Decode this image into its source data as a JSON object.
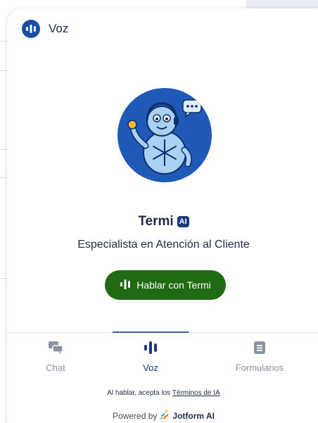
{
  "header": {
    "title": "Voz",
    "logo_icon": "voice-bars-icon",
    "accent": "#1b4ea3"
  },
  "agent": {
    "name": "Termi",
    "badge": "AI",
    "role": "Especialista en Atención al Cliente",
    "avatar_icon": "snowman-agent-avatar"
  },
  "talk_button": {
    "label": "Hablar con Termi",
    "icon": "voice-bars-icon",
    "color": "#1f6a12"
  },
  "tabs": [
    {
      "label": "Chat",
      "icon": "chat-bubbles-icon",
      "active": false
    },
    {
      "label": "Voz",
      "icon": "voice-bars-icon",
      "active": true
    },
    {
      "label": "Formularios",
      "icon": "form-document-icon",
      "active": false
    }
  ],
  "footer": {
    "terms_prefix": "Al hablar, acepta los",
    "terms_link": "Términos de IA",
    "powered_by": "Powered by",
    "brand": "Jotform AI"
  },
  "colors": {
    "tab_active": "#1b3a7a",
    "tab_inactive": "#8a93a3"
  }
}
